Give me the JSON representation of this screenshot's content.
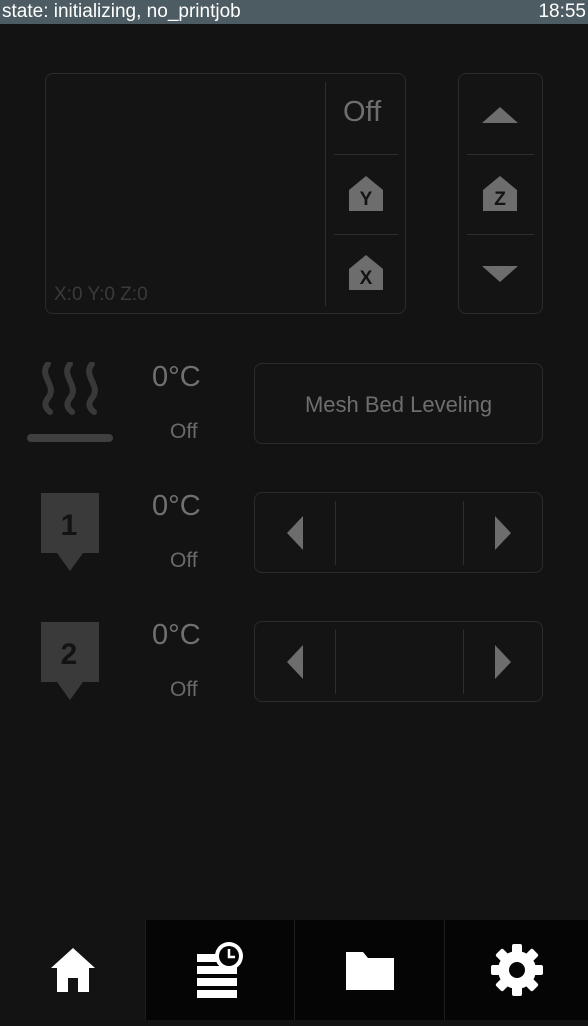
{
  "status_bar": {
    "state": "state: initializing, no_printjob",
    "time": "18:55"
  },
  "jog": {
    "coords": "X:0 Y:0 Z:0",
    "motor_state": "Off",
    "home_y_label": "Y",
    "home_x_label": "X",
    "home_z_label": "Z"
  },
  "bed": {
    "temp": "0°C",
    "state": "Off",
    "button_label": "Mesh Bed Leveling"
  },
  "extruders": [
    {
      "label": "1",
      "temp": "0°C",
      "state": "Off"
    },
    {
      "label": "2",
      "temp": "0°C",
      "state": "Off"
    }
  ],
  "nav": {
    "items": [
      {
        "icon": "home-icon"
      },
      {
        "icon": "history-icon"
      },
      {
        "icon": "folder-icon"
      },
      {
        "icon": "gear-icon"
      }
    ]
  }
}
